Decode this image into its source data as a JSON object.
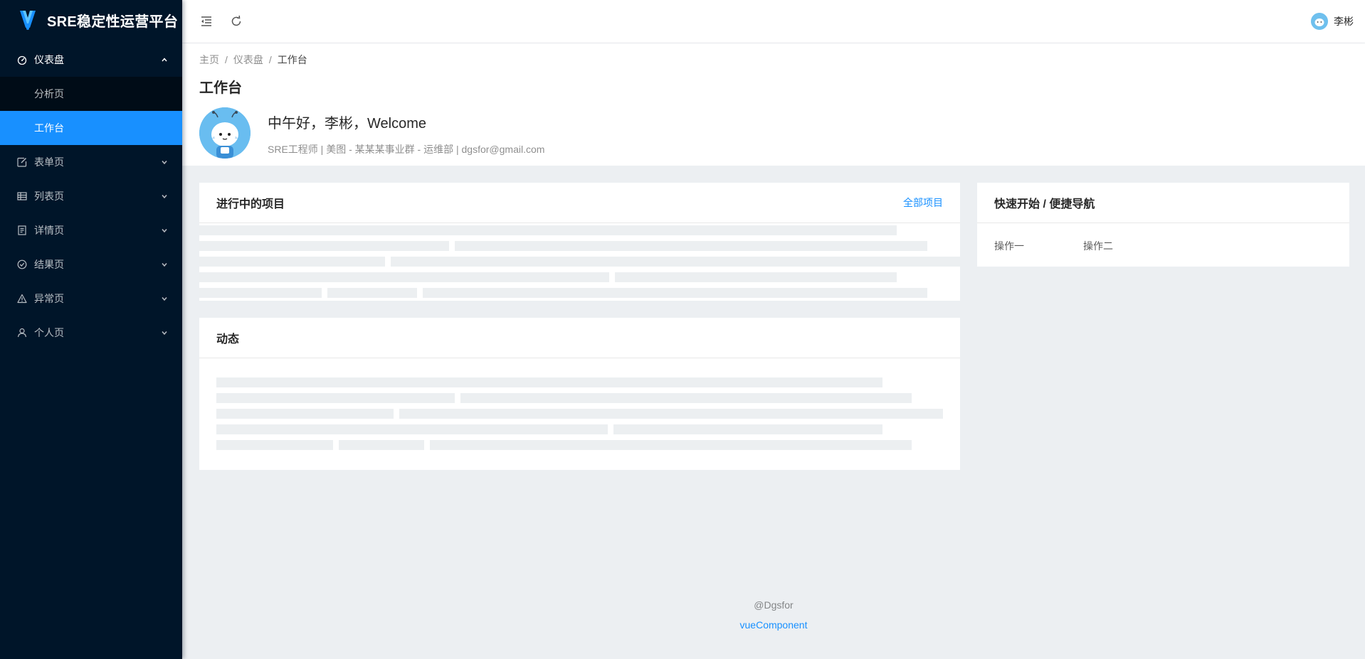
{
  "app": {
    "title": "SRE稳定性运营平台",
    "logo_icon": "v-logo-icon",
    "accent_color": "#1890ff"
  },
  "sidebar": {
    "items": [
      {
        "label": "仪表盘",
        "icon": "dashboard-icon",
        "open": true,
        "children": [
          {
            "label": "分析页",
            "active": false
          },
          {
            "label": "工作台",
            "active": true
          }
        ]
      },
      {
        "label": "表单页",
        "icon": "form-edit-icon"
      },
      {
        "label": "列表页",
        "icon": "table-icon"
      },
      {
        "label": "详情页",
        "icon": "profile-icon"
      },
      {
        "label": "结果页",
        "icon": "check-circle-icon"
      },
      {
        "label": "异常页",
        "icon": "warning-icon"
      },
      {
        "label": "个人页",
        "icon": "user-icon"
      }
    ]
  },
  "header": {
    "user_name": "李彬"
  },
  "breadcrumb": [
    "主页",
    "仪表盘",
    "工作台"
  ],
  "page": {
    "title": "工作台",
    "greeting": "中午好，李彬，Welcome",
    "profile": "SRE工程师 | 美图 - 某某某事业群 - 运维部 | dgsfor@gmail.com"
  },
  "projects_card": {
    "title": "进行中的项目",
    "extra": "全部项目"
  },
  "dynamic_card": {
    "title": "动态"
  },
  "quick_card": {
    "title": "快速开始 / 便捷导航",
    "links": [
      "操作一",
      "操作二"
    ]
  },
  "footer": {
    "copyright": "@Dgsfor",
    "link": "vueComponent"
  }
}
